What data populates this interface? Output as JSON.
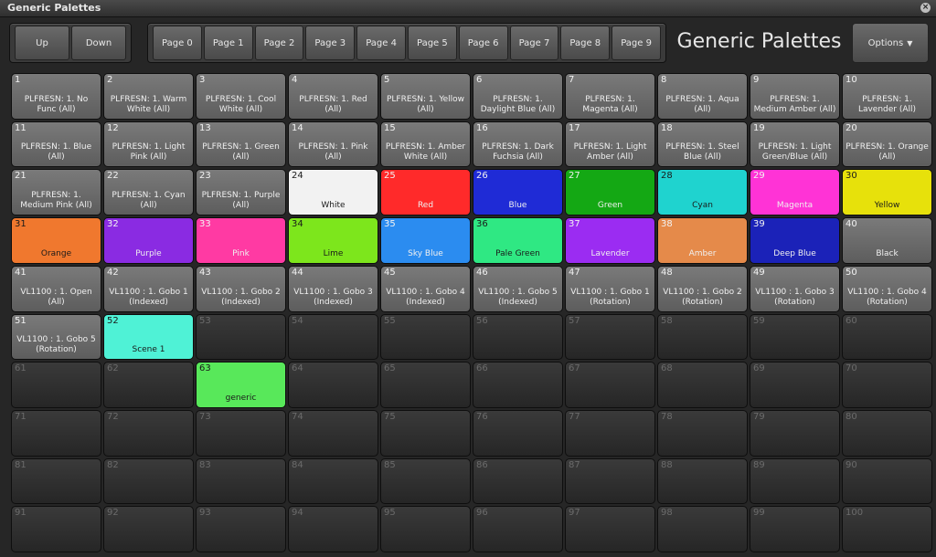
{
  "window": {
    "title": "Generic Palettes"
  },
  "header": {
    "title": "Generic Palettes",
    "options_label": "Options",
    "nav": [
      "Up",
      "Down"
    ],
    "pages": [
      "Page 0",
      "Page 1",
      "Page 2",
      "Page 3",
      "Page 4",
      "Page 5",
      "Page 6",
      "Page 7",
      "Page 8",
      "Page 9"
    ]
  },
  "cells": [
    {
      "n": "1",
      "label": "PLFRESN: 1. No Func (All)"
    },
    {
      "n": "2",
      "label": "PLFRESN: 1. Warm White (All)"
    },
    {
      "n": "3",
      "label": "PLFRESN: 1. Cool White (All)"
    },
    {
      "n": "4",
      "label": "PLFRESN: 1. Red (All)"
    },
    {
      "n": "5",
      "label": "PLFRESN: 1. Yellow (All)"
    },
    {
      "n": "6",
      "label": "PLFRESN: 1. Daylight Blue (All)"
    },
    {
      "n": "7",
      "label": "PLFRESN: 1. Magenta (All)"
    },
    {
      "n": "8",
      "label": "PLFRESN: 1. Aqua (All)"
    },
    {
      "n": "9",
      "label": "PLFRESN: 1. Medium Amber (All)"
    },
    {
      "n": "10",
      "label": "PLFRESN: 1. Lavender (All)"
    },
    {
      "n": "11",
      "label": "PLFRESN: 1. Blue (All)"
    },
    {
      "n": "12",
      "label": "PLFRESN: 1. Light Pink (All)"
    },
    {
      "n": "13",
      "label": "PLFRESN: 1. Green (All)"
    },
    {
      "n": "14",
      "label": "PLFRESN: 1. Pink (All)"
    },
    {
      "n": "15",
      "label": "PLFRESN: 1. Amber White (All)"
    },
    {
      "n": "16",
      "label": "PLFRESN: 1. Dark Fuchsia (All)"
    },
    {
      "n": "17",
      "label": "PLFRESN: 1. Light Amber (All)"
    },
    {
      "n": "18",
      "label": "PLFRESN: 1. Steel Blue (All)"
    },
    {
      "n": "19",
      "label": "PLFRESN: 1. Light Green/Blue (All)"
    },
    {
      "n": "20",
      "label": "PLFRESN: 1. Orange (All)"
    },
    {
      "n": "21",
      "label": "PLFRESN: 1. Medium Pink (All)"
    },
    {
      "n": "22",
      "label": "PLFRESN: 1. Cyan (All)"
    },
    {
      "n": "23",
      "label": "PLFRESN: 1. Purple (All)"
    },
    {
      "n": "24",
      "label": "White",
      "color": "#f2f2f2",
      "dark": true
    },
    {
      "n": "25",
      "label": "Red",
      "color": "#ff2a2a"
    },
    {
      "n": "26",
      "label": "Blue",
      "color": "#1f2bd6"
    },
    {
      "n": "27",
      "label": "Green",
      "color": "#14a814"
    },
    {
      "n": "28",
      "label": "Cyan",
      "color": "#1fd3cf",
      "dark": true
    },
    {
      "n": "29",
      "label": "Magenta",
      "color": "#ff33d6"
    },
    {
      "n": "30",
      "label": "Yellow",
      "color": "#e7e10b",
      "dark": true
    },
    {
      "n": "31",
      "label": "Orange",
      "color": "#f0782e",
      "dark": true
    },
    {
      "n": "32",
      "label": "Purple",
      "color": "#8a2be2"
    },
    {
      "n": "33",
      "label": "Pink",
      "color": "#ff3aa3"
    },
    {
      "n": "34",
      "label": "Lime",
      "color": "#7de61c",
      "dark": true
    },
    {
      "n": "35",
      "label": "Sky Blue",
      "color": "#2b8cf0"
    },
    {
      "n": "36",
      "label": "Pale Green",
      "color": "#2fe883",
      "dark": true
    },
    {
      "n": "37",
      "label": "Lavender",
      "color": "#9b2cf2"
    },
    {
      "n": "38",
      "label": "Amber",
      "color": "#e58a4a"
    },
    {
      "n": "39",
      "label": "Deep Blue",
      "color": "#1b22b8"
    },
    {
      "n": "40",
      "label": "Black"
    },
    {
      "n": "41",
      "label": "VL1100 : 1. Open (All)"
    },
    {
      "n": "42",
      "label": "VL1100 : 1. Gobo 1 (Indexed)"
    },
    {
      "n": "43",
      "label": "VL1100 : 1. Gobo 2 (Indexed)"
    },
    {
      "n": "44",
      "label": "VL1100 : 1. Gobo 3 (Indexed)"
    },
    {
      "n": "45",
      "label": "VL1100 : 1. Gobo 4 (Indexed)"
    },
    {
      "n": "46",
      "label": "VL1100 : 1. Gobo 5 (Indexed)"
    },
    {
      "n": "47",
      "label": "VL1100 : 1. Gobo 1 (Rotation)"
    },
    {
      "n": "48",
      "label": "VL1100 : 1. Gobo 2 (Rotation)"
    },
    {
      "n": "49",
      "label": "VL1100 : 1. Gobo 3 (Rotation)"
    },
    {
      "n": "50",
      "label": "VL1100 : 1. Gobo 4 (Rotation)"
    },
    {
      "n": "51",
      "label": "VL1100 : 1. Gobo 5 (Rotation)"
    },
    {
      "n": "52",
      "label": "Scene 1",
      "color": "#4ff2d6",
      "dark": true
    },
    {
      "n": "53",
      "empty": true
    },
    {
      "n": "54",
      "empty": true
    },
    {
      "n": "55",
      "empty": true
    },
    {
      "n": "56",
      "empty": true
    },
    {
      "n": "57",
      "empty": true
    },
    {
      "n": "58",
      "empty": true
    },
    {
      "n": "59",
      "empty": true
    },
    {
      "n": "60",
      "empty": true
    },
    {
      "n": "61",
      "empty": true
    },
    {
      "n": "62",
      "empty": true
    },
    {
      "n": "63",
      "label": "generic",
      "color": "#58e85a",
      "dark": true
    },
    {
      "n": "64",
      "empty": true
    },
    {
      "n": "65",
      "empty": true
    },
    {
      "n": "66",
      "empty": true
    },
    {
      "n": "67",
      "empty": true
    },
    {
      "n": "68",
      "empty": true
    },
    {
      "n": "69",
      "empty": true
    },
    {
      "n": "70",
      "empty": true
    },
    {
      "n": "71",
      "empty": true
    },
    {
      "n": "72",
      "empty": true
    },
    {
      "n": "73",
      "empty": true
    },
    {
      "n": "74",
      "empty": true
    },
    {
      "n": "75",
      "empty": true
    },
    {
      "n": "76",
      "empty": true
    },
    {
      "n": "77",
      "empty": true
    },
    {
      "n": "78",
      "empty": true
    },
    {
      "n": "79",
      "empty": true
    },
    {
      "n": "80",
      "empty": true
    },
    {
      "n": "81",
      "empty": true
    },
    {
      "n": "82",
      "empty": true
    },
    {
      "n": "83",
      "empty": true
    },
    {
      "n": "84",
      "empty": true
    },
    {
      "n": "85",
      "empty": true
    },
    {
      "n": "86",
      "empty": true
    },
    {
      "n": "87",
      "empty": true
    },
    {
      "n": "88",
      "empty": true
    },
    {
      "n": "89",
      "empty": true
    },
    {
      "n": "90",
      "empty": true
    },
    {
      "n": "91",
      "empty": true
    },
    {
      "n": "92",
      "empty": true
    },
    {
      "n": "93",
      "empty": true
    },
    {
      "n": "94",
      "empty": true
    },
    {
      "n": "95",
      "empty": true
    },
    {
      "n": "96",
      "empty": true
    },
    {
      "n": "97",
      "empty": true
    },
    {
      "n": "98",
      "empty": true
    },
    {
      "n": "99",
      "empty": true
    },
    {
      "n": "100",
      "empty": true
    }
  ]
}
